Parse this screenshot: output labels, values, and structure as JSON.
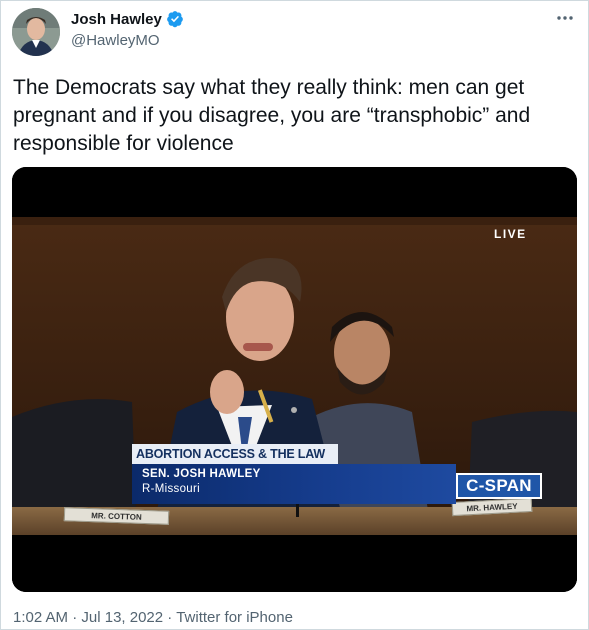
{
  "author": {
    "name": "Josh Hawley",
    "handle": "@HawleyMO",
    "verified": true
  },
  "tweet": {
    "text": "The Democrats say what they really think: men can get pregnant and if you disagree, you are “transphobic” and responsible for violence",
    "more_icon": "more-dots-icon"
  },
  "video": {
    "live_badge": "LIVE",
    "chyron_title": "ABORTION ACCESS & THE LAW",
    "chyron_name": "SEN. JOSH HAWLEY",
    "chyron_affiliation": "R-Missouri",
    "network_logo": "C-SPAN",
    "nameplate_left": "MR. COTTON",
    "nameplate_right": "MR. HAWLEY"
  },
  "meta": {
    "time": "1:02 AM",
    "separator": "·",
    "date": "Jul 13, 2022",
    "source": "Twitter for iPhone"
  },
  "colors": {
    "verified_blue": "#1d9bf0",
    "text_primary": "#0f1419",
    "text_secondary": "#536471",
    "cspan_blue": "#1f56a8"
  }
}
